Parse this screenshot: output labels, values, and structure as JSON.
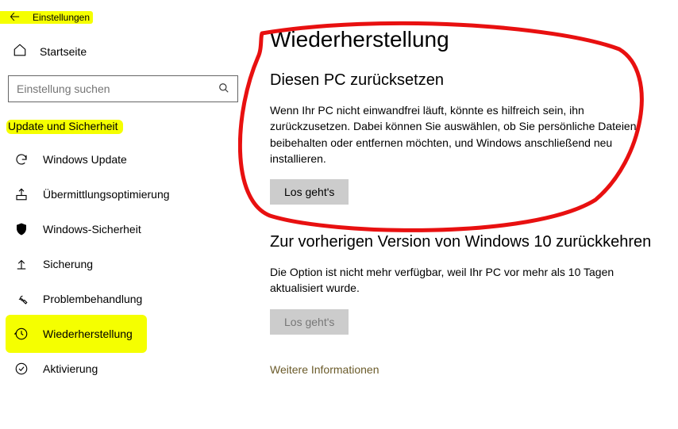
{
  "header": {
    "title": "Einstellungen"
  },
  "home": {
    "label": "Startseite"
  },
  "search": {
    "placeholder": "Einstellung suchen"
  },
  "category": {
    "label": "Update und Sicherheit"
  },
  "nav": {
    "items": [
      {
        "id": "windows-update",
        "label": "Windows Update"
      },
      {
        "id": "delivery-optimization",
        "label": "Übermittlungsoptimierung"
      },
      {
        "id": "windows-security",
        "label": "Windows-Sicherheit"
      },
      {
        "id": "backup",
        "label": "Sicherung"
      },
      {
        "id": "troubleshoot",
        "label": "Problembehandlung"
      },
      {
        "id": "recovery",
        "label": "Wiederherstellung"
      },
      {
        "id": "activation",
        "label": "Aktivierung"
      }
    ]
  },
  "page": {
    "title": "Wiederherstellung",
    "reset": {
      "heading": "Diesen PC zurücksetzen",
      "body": "Wenn Ihr PC nicht einwandfrei läuft, könnte es hilfreich sein, ihn zurückzusetzen. Dabei können Sie auswählen, ob Sie persönliche Dateien beibehalten oder entfernen möchten, und Windows anschließend neu installieren.",
      "button": "Los geht's"
    },
    "goback": {
      "heading": "Zur vorherigen Version von Windows 10 zurückkehren",
      "body": "Die Option ist nicht mehr verfügbar, weil Ihr PC vor mehr als 10 Tagen aktualisiert wurde.",
      "button": "Los geht's"
    },
    "more_info": "Weitere Informationen"
  }
}
